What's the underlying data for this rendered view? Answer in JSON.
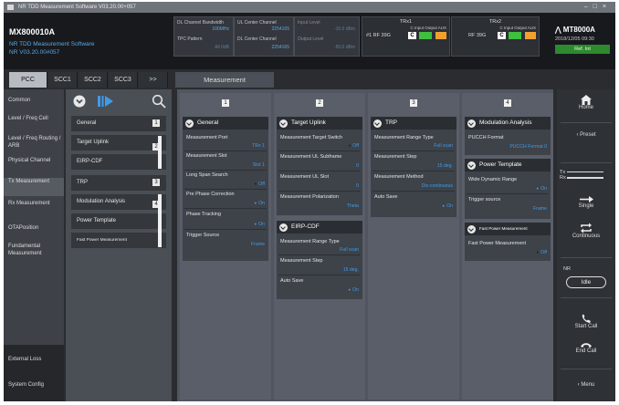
{
  "window_title": "NR TDD Measurement Software V03.20.00+057",
  "header": {
    "app_id": "MX800010A",
    "app_name": "NR TDD Measurement Software",
    "app_version": "NR V03.20.00#057",
    "params1": {
      "dl_bw_label": "DL Channel Bandwidth",
      "dl_bw_value": "100MHz",
      "tpc_label": "TPC Pattern",
      "tpc_value": "All 0dB"
    },
    "params2": {
      "ul_ch_label": "UL Center Channel",
      "ul_ch_value": "2254165",
      "dl_ch_label": "DL Center Channel",
      "dl_ch_value": "2254165"
    },
    "params3": {
      "in_label": "Input Level",
      "in_value": "-10.0 dBm",
      "out_label": "Output Level",
      "out_value": "-50.0 dBm"
    },
    "trx1": {
      "title": "TRx1",
      "io": "C  Input  Output  AUX",
      "rf": "#1  RF 39G",
      "c": "C"
    },
    "trx2": {
      "title": "TRx2",
      "io": "C  Input  Output  AUX",
      "rf": "RF 39G",
      "c": "C"
    },
    "brand": "MT8000A",
    "datetime": "2018/12/05 09:30",
    "ref_badge": "Ref. Int"
  },
  "tabs": [
    "PCC",
    "SCC1",
    "SCC2",
    "SCC3",
    ">>"
  ],
  "main_tab": "Measurement",
  "nav": {
    "items": [
      "Common",
      "Level / Freq Cell",
      "Level / Freq Routing / ARB",
      "Physical Channel",
      "Tx Measurement",
      "Rx Measurement",
      "OTAPosition",
      "Fundamental Measurement"
    ],
    "bottom": [
      "External Loss",
      "System Config"
    ]
  },
  "submenu": {
    "items": [
      "General",
      "Target Uplink",
      "EIRP-CDF",
      "TRP",
      "Modulation Analysis",
      "Power Template",
      "Fast Power Measurement"
    ],
    "nums": [
      "1",
      "2",
      "3",
      "4"
    ]
  },
  "columns": [
    "1",
    "2",
    "3",
    "4"
  ],
  "panels": {
    "general": {
      "title": "General",
      "rows": [
        {
          "label": "Measurement Port",
          "value": "TRx 1"
        },
        {
          "label": "Measurement Slot",
          "value": "Slot 1"
        },
        {
          "label": "Long Span Search",
          "value": "Off"
        },
        {
          "label": "Pre Phase Correction",
          "value": "On"
        },
        {
          "label": "Phase Tracking",
          "value": "On"
        },
        {
          "label": "Trigger Source",
          "value": "Frame"
        }
      ]
    },
    "target_uplink": {
      "title": "Target Uplink",
      "rows": [
        {
          "label": "Measurement Target Switch",
          "value": "Off"
        },
        {
          "label": "Measurement UL Subframe",
          "value": "0"
        },
        {
          "label": "Measurement UL Slot",
          "value": "0"
        },
        {
          "label": "Measurement Polarization",
          "value": "Theta"
        }
      ]
    },
    "eirp_cdf": {
      "title": "EIRP-CDF",
      "rows": [
        {
          "label": "Measurement Range Type",
          "value": "Full scan"
        },
        {
          "label": "Measurement Step",
          "value": "15 deg."
        },
        {
          "label": "Auto Save",
          "value": "On"
        }
      ]
    },
    "trp": {
      "title": "TRP",
      "rows": [
        {
          "label": "Measurement Range Type",
          "value": "Full scan"
        },
        {
          "label": "Measurement Step",
          "value": "15 deg."
        },
        {
          "label": "Measurement Method",
          "value": "Dis-continuous"
        },
        {
          "label": "Auto Save",
          "value": "On"
        }
      ]
    },
    "modulation": {
      "title": "Modulation Analysis",
      "rows": [
        {
          "label": "PUCCH Format",
          "value": "PUCCH Format 0"
        }
      ]
    },
    "power_template": {
      "title": "Power Template",
      "rows": [
        {
          "label": "Wide Dynamic Range",
          "value": "On"
        },
        {
          "label": "Trigger source",
          "value": "Frame"
        }
      ]
    },
    "fast_power": {
      "title": "Fast Power Measurement",
      "rows": [
        {
          "label": "Fast Power Measurement",
          "value": "Off"
        }
      ]
    }
  },
  "right": {
    "home": "Home",
    "preset": "Preset",
    "tx": "Tx",
    "rx": "Rx",
    "single": "Single",
    "continuous": "Continuous",
    "nr": "NR",
    "status": "Idle",
    "start_call": "Start Call",
    "end_call": "End Call",
    "menu": "Menu"
  },
  "colors": {
    "accent": "#3f9be8",
    "ref_green": "#2d8a2d",
    "green_ind": "#3fbf3f",
    "orange_ind": "#f0a030"
  }
}
